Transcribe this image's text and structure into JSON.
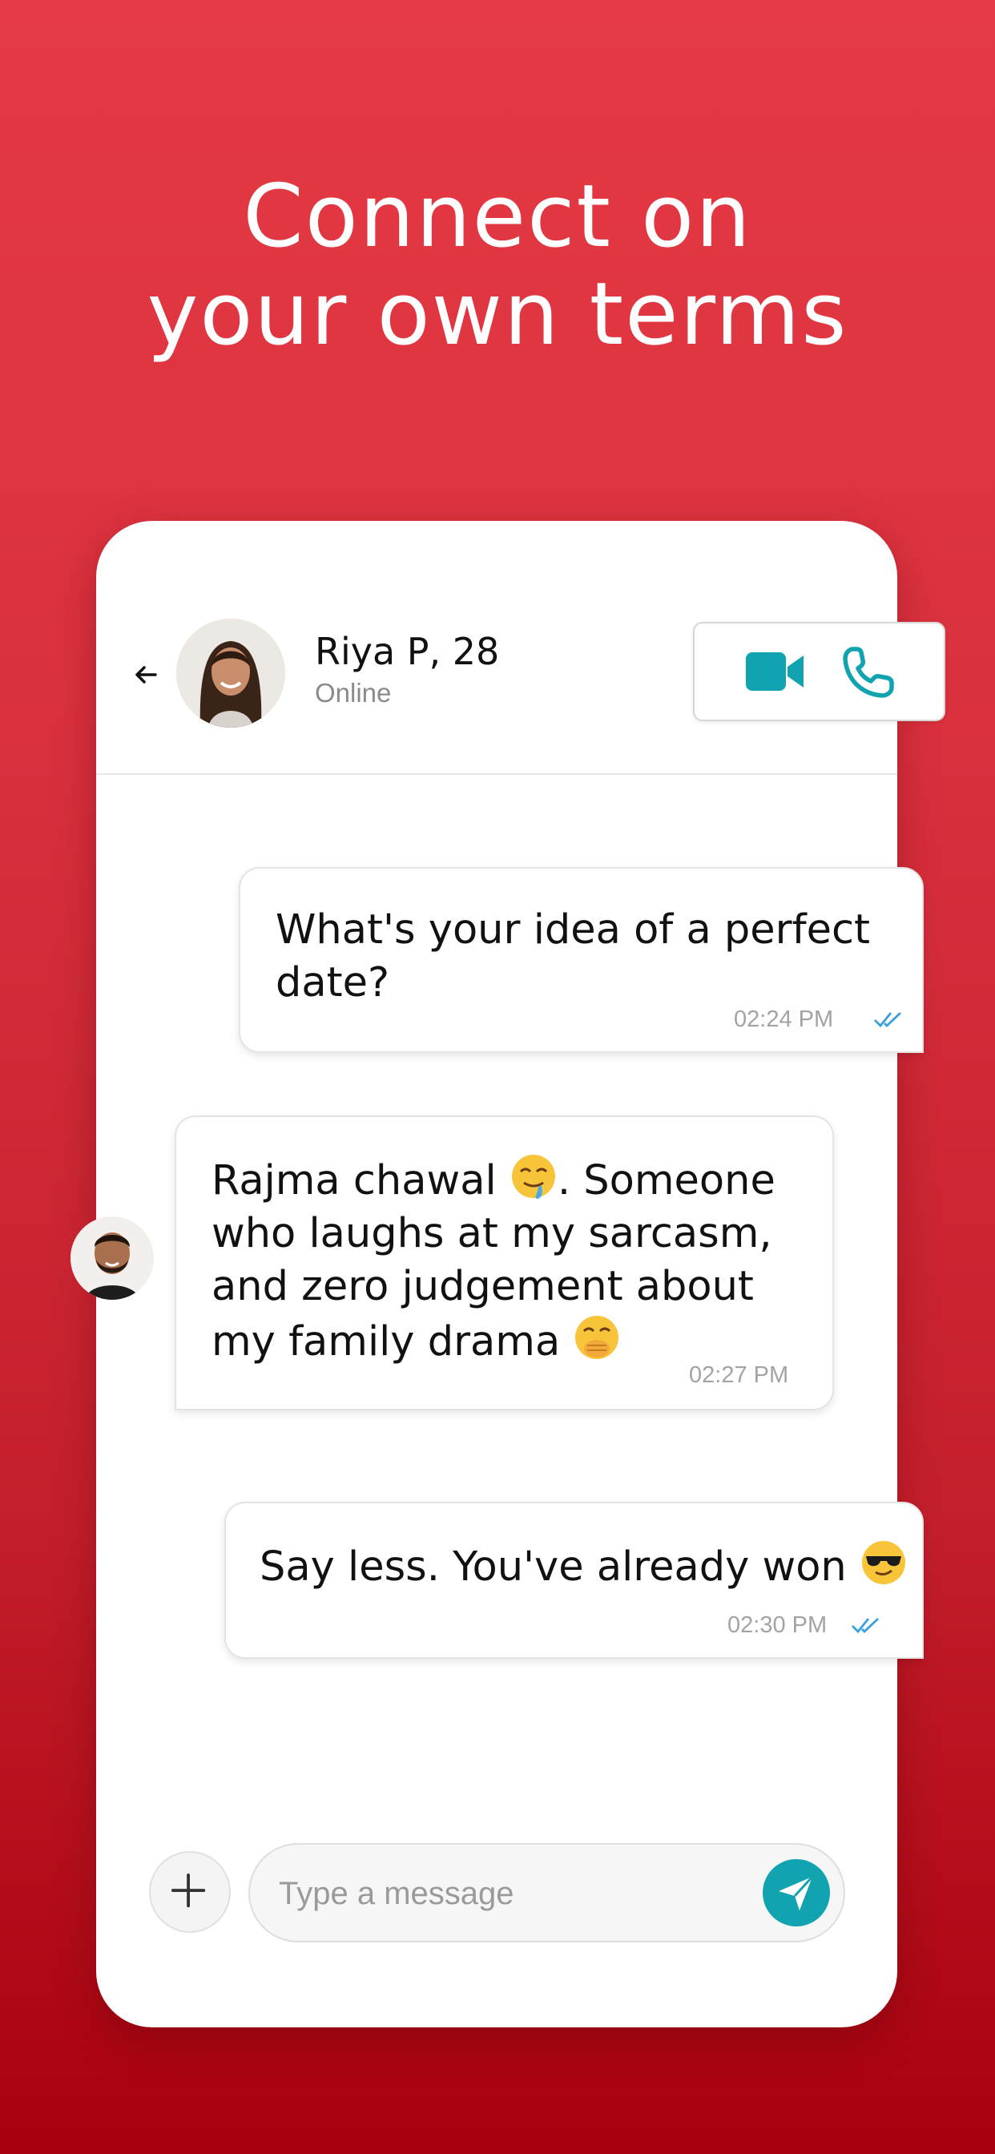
{
  "headline": {
    "line1": "Connect on",
    "line2": "your own terms"
  },
  "chat": {
    "contact": {
      "name": "Riya P, 28",
      "status": "Online"
    },
    "messages": [
      {
        "direction": "outgoing",
        "lines": [
          "What's your idea of a perfect",
          "date?"
        ],
        "time": "02:24 PM",
        "read": true
      },
      {
        "direction": "incoming",
        "line1_text": "Rajma chawal",
        "line1_rest": ". Someone",
        "line2": "who laughs at my sarcasm,",
        "line3": "and zero judgement about",
        "line4": "my family drama",
        "time": "02:27 PM"
      },
      {
        "direction": "outgoing",
        "text": "Say less. You've already won",
        "time": "02:30 PM",
        "read": true
      }
    ],
    "composer": {
      "placeholder": "Type a message"
    }
  },
  "colors": {
    "accent": "#12a3b0",
    "background_top": "#e53a44",
    "background_bottom": "#a8000e",
    "read_ticks": "#3aa0e0"
  },
  "icons": [
    "back-arrow-icon",
    "video-call-icon",
    "phone-call-icon",
    "drooling-emoji",
    "hand-over-mouth-emoji",
    "sunglasses-emoji",
    "plus-icon",
    "send-icon",
    "double-check-icon"
  ]
}
